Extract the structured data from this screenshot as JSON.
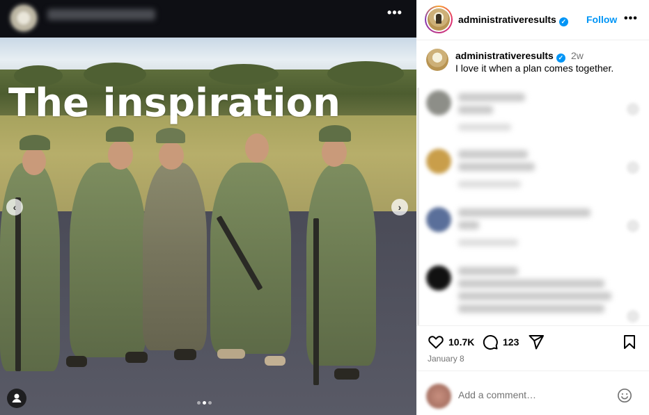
{
  "post": {
    "overlay_text": "The inspiration",
    "carousel": {
      "slide_count": 3,
      "active_index": 1
    }
  },
  "header": {
    "username": "administrativeresults",
    "follow_label": "Follow",
    "more_label": "•••"
  },
  "caption": {
    "username": "administrativeresults",
    "time": "2w",
    "text": "I love it when a plan comes together."
  },
  "actions": {
    "likes": "10.7K",
    "comments": "123",
    "date": "January 8"
  },
  "add_comment": {
    "placeholder": "Add a comment…"
  },
  "icons": {
    "verified": "verified-badge-icon",
    "like": "heart-icon",
    "comment": "comment-bubble-icon",
    "share": "send-icon",
    "save": "bookmark-icon",
    "emoji": "emoji-icon",
    "prev": "chevron-left-icon",
    "next": "chevron-right-icon",
    "tag": "user-tag-icon"
  },
  "colors": {
    "accent_blue": "#0095f6",
    "muted_text": "#737373",
    "divider": "#efefef"
  }
}
